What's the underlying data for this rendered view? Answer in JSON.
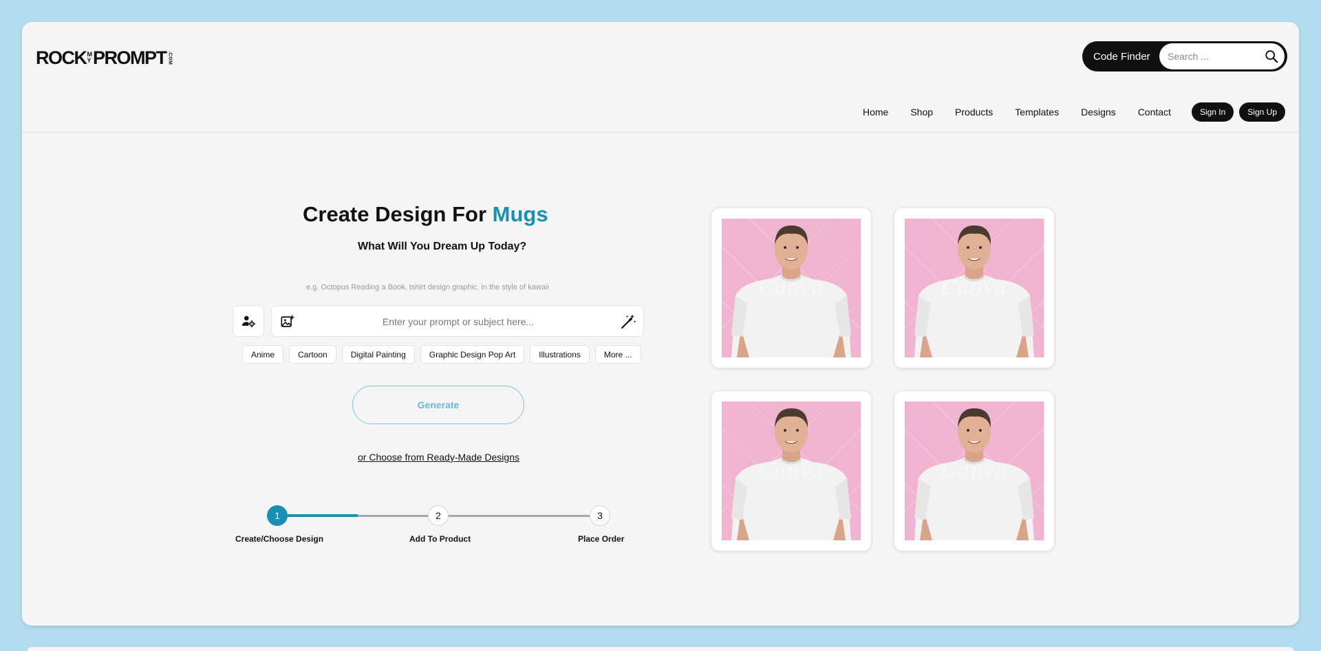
{
  "header": {
    "logo": {
      "part1": "ROCK",
      "my_top": "M",
      "my_bottom": "Y",
      "part2": "PROMPT",
      "suffix": ".COM"
    },
    "code_finder_label": "Code Finder",
    "search_placeholder": "Search ...",
    "nav": [
      {
        "label": "Home"
      },
      {
        "label": "Shop"
      },
      {
        "label": "Products"
      },
      {
        "label": "Templates"
      },
      {
        "label": "Designs"
      },
      {
        "label": "Contact"
      }
    ],
    "sign_in": "Sign In",
    "sign_up": "Sign Up"
  },
  "main": {
    "title_prefix": "Create Design For",
    "title_accent": "Mugs",
    "subtitle": "What Will You Dream Up Today?",
    "example_text": "e.g. Octopus Reading a Book, tshirt design graphic, in the style of kawaii",
    "prompt_placeholder": "Enter your prompt or subject here...",
    "style_chips": [
      "Anime",
      "Cartoon",
      "Digital Painting",
      "Graphic Design Pop Art",
      "Illustrations",
      "More ..."
    ],
    "generate_label": "Generate",
    "ready_made_link": "or Choose from Ready-Made Designs"
  },
  "stepper": {
    "progress": 0.25,
    "steps": [
      {
        "number": "1",
        "label": "Create/Choose Design",
        "active": true
      },
      {
        "number": "2",
        "label": "Add To Product",
        "active": false
      },
      {
        "number": "3",
        "label": "Place Order",
        "active": false
      }
    ]
  },
  "gallery": {
    "watermark": "Canva",
    "cards": [
      "man-white-tshirt-photo",
      "man-white-tshirt-photo",
      "man-white-tshirt-photo",
      "man-white-tshirt-photo"
    ]
  },
  "colors": {
    "accent": "#1a8fb4",
    "page_bg": "#b3dcee",
    "panel_bg": "#f5f5f5",
    "photo_bg": "#f0b4d0"
  }
}
